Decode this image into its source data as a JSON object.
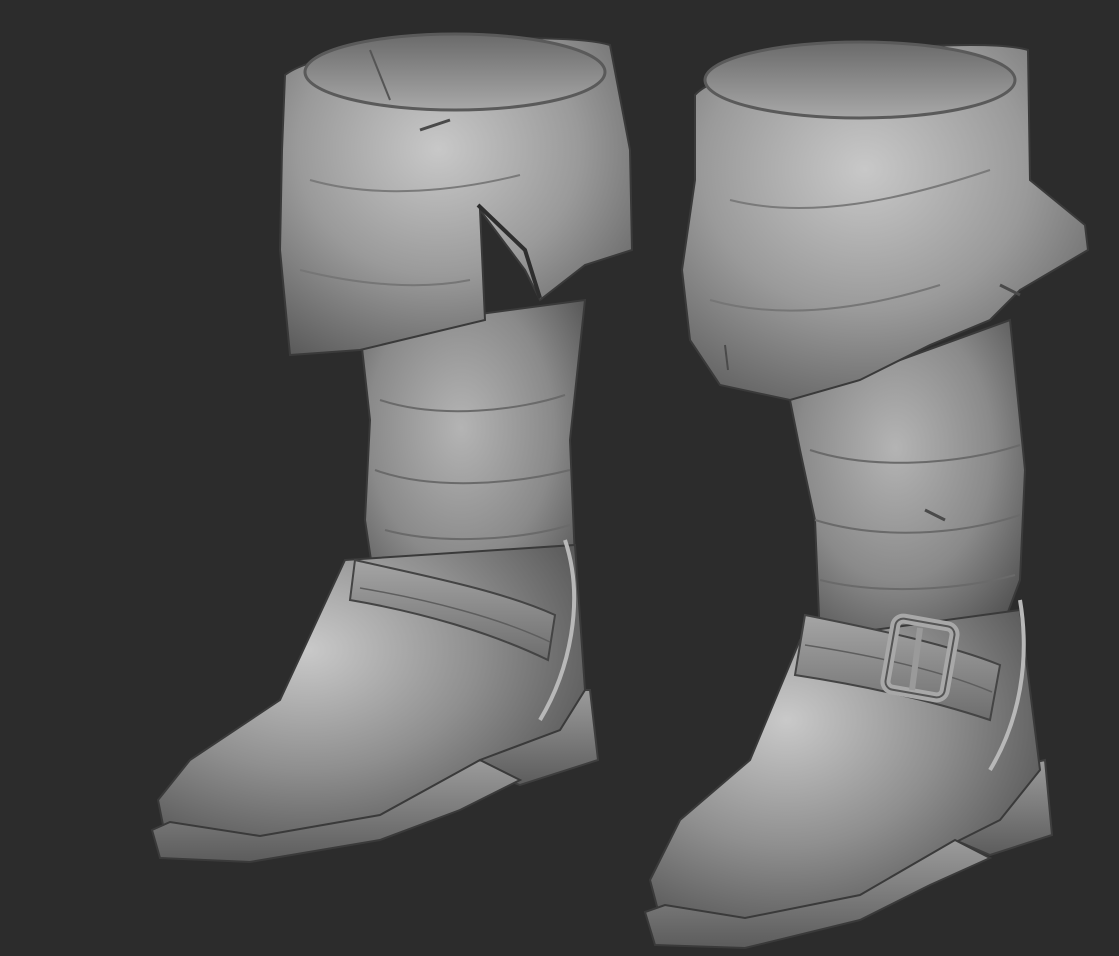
{
  "viewport": {
    "background_color": "#2c2c2c"
  },
  "model": {
    "material_color": "#8a8a8a",
    "highlight_color": "#d6d6d6",
    "shadow_color": "#3a3a3a",
    "boots": [
      {
        "side": "left",
        "features": [
          "folded-cuff",
          "cuff-slit",
          "ankle-strap",
          "heel"
        ]
      },
      {
        "side": "right",
        "features": [
          "folded-cuff",
          "ankle-strap",
          "buckle",
          "heel"
        ]
      }
    ]
  }
}
